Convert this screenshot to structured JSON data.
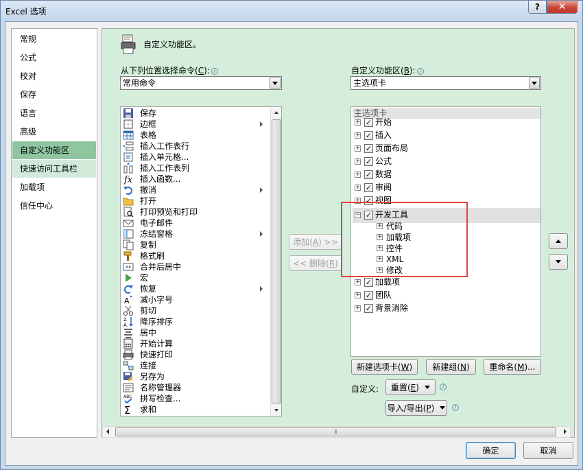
{
  "window": {
    "title": "Excel 选项",
    "help_label": "?",
    "close_label": "✕"
  },
  "nav": {
    "items": [
      {
        "label": "常规"
      },
      {
        "label": "公式"
      },
      {
        "label": "校对"
      },
      {
        "label": "保存"
      },
      {
        "label": "语言"
      },
      {
        "label": "高级"
      },
      {
        "label": "自定义功能区",
        "state": "selected"
      },
      {
        "label": "快速访问工具栏",
        "state": "hover"
      },
      {
        "label": "加载项"
      },
      {
        "label": "信任中心"
      }
    ]
  },
  "header": {
    "title": "自定义功能区。",
    "icon": "customize-ribbon-icon"
  },
  "left": {
    "label_prefix": "从下列位置选择命令(",
    "label_key": "C",
    "label_suffix": "):",
    "info": "i",
    "combo_value": "常用命令",
    "commands": [
      {
        "label": "保存",
        "icon": "save-icon",
        "submenu": false
      },
      {
        "label": "边框",
        "icon": "borders-icon",
        "submenu": true
      },
      {
        "label": "表格",
        "icon": "table-icon",
        "submenu": false
      },
      {
        "label": "插入工作表行",
        "icon": "insert-row-icon",
        "submenu": false
      },
      {
        "label": "插入单元格...",
        "icon": "insert-cells-icon",
        "submenu": false
      },
      {
        "label": "插入工作表列",
        "icon": "insert-column-icon",
        "submenu": false
      },
      {
        "label": "插入函数...",
        "icon": "function-icon",
        "submenu": false
      },
      {
        "label": "撤消",
        "icon": "undo-icon",
        "submenu": true
      },
      {
        "label": "打开",
        "icon": "open-folder-icon",
        "submenu": false
      },
      {
        "label": "打印预览和打印",
        "icon": "print-preview-icon",
        "submenu": false
      },
      {
        "label": "电子邮件",
        "icon": "email-icon",
        "submenu": false
      },
      {
        "label": "冻结窗格",
        "icon": "freeze-panes-icon",
        "submenu": true
      },
      {
        "label": "复制",
        "icon": "copy-icon",
        "submenu": false
      },
      {
        "label": "格式刷",
        "icon": "format-painter-icon",
        "submenu": false
      },
      {
        "label": "合并后居中",
        "icon": "merge-center-icon",
        "submenu": false
      },
      {
        "label": "宏",
        "icon": "macro-icon",
        "submenu": false
      },
      {
        "label": "恢复",
        "icon": "redo-icon",
        "submenu": true
      },
      {
        "label": "减小字号",
        "icon": "decrease-font-icon",
        "submenu": false
      },
      {
        "label": "剪切",
        "icon": "cut-icon",
        "submenu": false
      },
      {
        "label": "降序排序",
        "icon": "sort-descending-icon",
        "submenu": false
      },
      {
        "label": "居中",
        "icon": "center-align-icon",
        "submenu": false
      },
      {
        "label": "开始计算",
        "icon": "calculator-icon",
        "submenu": false
      },
      {
        "label": "快速打印",
        "icon": "quick-print-icon",
        "submenu": false
      },
      {
        "label": "连接",
        "icon": "connections-icon",
        "submenu": false
      },
      {
        "label": "另存为",
        "icon": "save-as-icon",
        "submenu": false
      },
      {
        "label": "名称管理器",
        "icon": "name-manager-icon",
        "submenu": false
      },
      {
        "label": "拼写检查...",
        "icon": "spelling-icon",
        "submenu": false
      },
      {
        "label": "求和",
        "icon": "sum-icon",
        "submenu": false
      }
    ]
  },
  "middle": {
    "add_label": "添加(",
    "add_key": "A",
    "add_suffix": ") >>",
    "remove_label": "<< 删除(",
    "remove_key": "R",
    "remove_suffix": ")"
  },
  "right": {
    "label_prefix": "自定义功能区(",
    "label_key": "B",
    "label_suffix": "):",
    "info": "i",
    "combo_value": "主选项卡",
    "group_header": "主选项卡",
    "tabs": [
      {
        "label": "开始",
        "checked": true,
        "expander": "+"
      },
      {
        "label": "插入",
        "checked": true,
        "expander": "+"
      },
      {
        "label": "页面布局",
        "checked": true,
        "expander": "+"
      },
      {
        "label": "公式",
        "checked": true,
        "expander": "+"
      },
      {
        "label": "数据",
        "checked": true,
        "expander": "+"
      },
      {
        "label": "审阅",
        "checked": true,
        "expander": "+"
      },
      {
        "label": "视图",
        "checked": true,
        "expander": "+"
      },
      {
        "label": "开发工具",
        "checked": true,
        "expander": "−"
      }
    ],
    "children": [
      {
        "label": "代码"
      },
      {
        "label": "加载项"
      },
      {
        "label": "控件"
      },
      {
        "label": "XML"
      },
      {
        "label": "修改"
      }
    ],
    "tabs_after": [
      {
        "label": "加载项",
        "checked": true,
        "expander": "+"
      },
      {
        "label": "团队",
        "checked": true,
        "expander": "+"
      },
      {
        "label": "背景消除",
        "checked": true,
        "expander": "+"
      }
    ],
    "check_mark": "✓",
    "new_tab": {
      "prefix": "新建选项卡(",
      "key": "W",
      "suffix": ")"
    },
    "new_group": {
      "prefix": "新建组(",
      "key": "N",
      "suffix": ")"
    },
    "rename": {
      "prefix": "重命名(",
      "key": "M",
      "suffix": ")..."
    },
    "customize_label": "自定义:",
    "reset": {
      "prefix": "重置(",
      "key": "E",
      "suffix": ")"
    },
    "import_export": {
      "prefix": "导入/导出(",
      "key": "P",
      "suffix": ")"
    }
  },
  "footer": {
    "ok": "确定",
    "cancel": "取消"
  },
  "colors": {
    "panel_bg": "#d5eedb",
    "nav_selected": "#8fc6a0",
    "highlight_box": "#e8403a"
  }
}
